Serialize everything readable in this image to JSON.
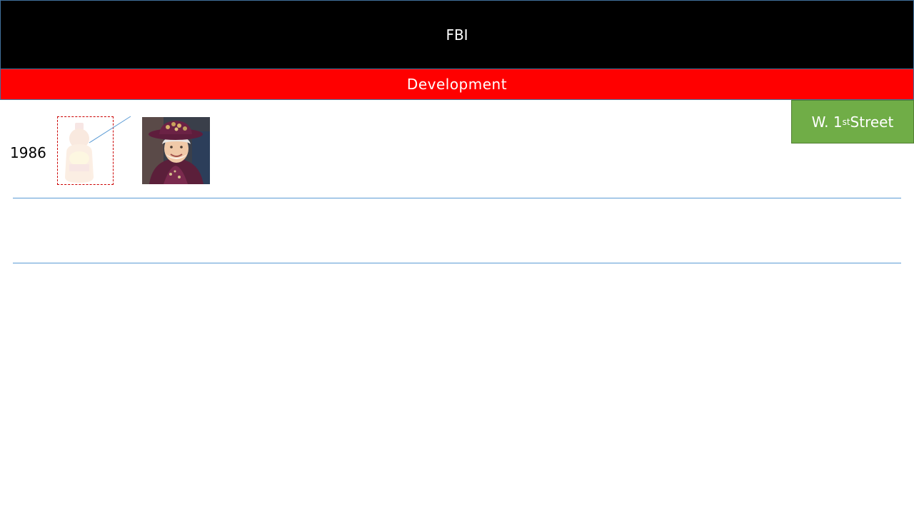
{
  "slide": {
    "title": "FBI",
    "subtitle": "Development",
    "street": {
      "prefix": "W. 1",
      "superscript": "st",
      "suffix": " Street"
    },
    "year": "1986"
  },
  "images": {
    "faded_item": "syrup-bottle-image",
    "portrait": "woman-in-purple-hat-portrait"
  },
  "colors": {
    "title_bg": "#000000",
    "subtitle_bg": "#ff0000",
    "street_bg": "#70ad47",
    "rule_line": "#5b9bd5"
  }
}
